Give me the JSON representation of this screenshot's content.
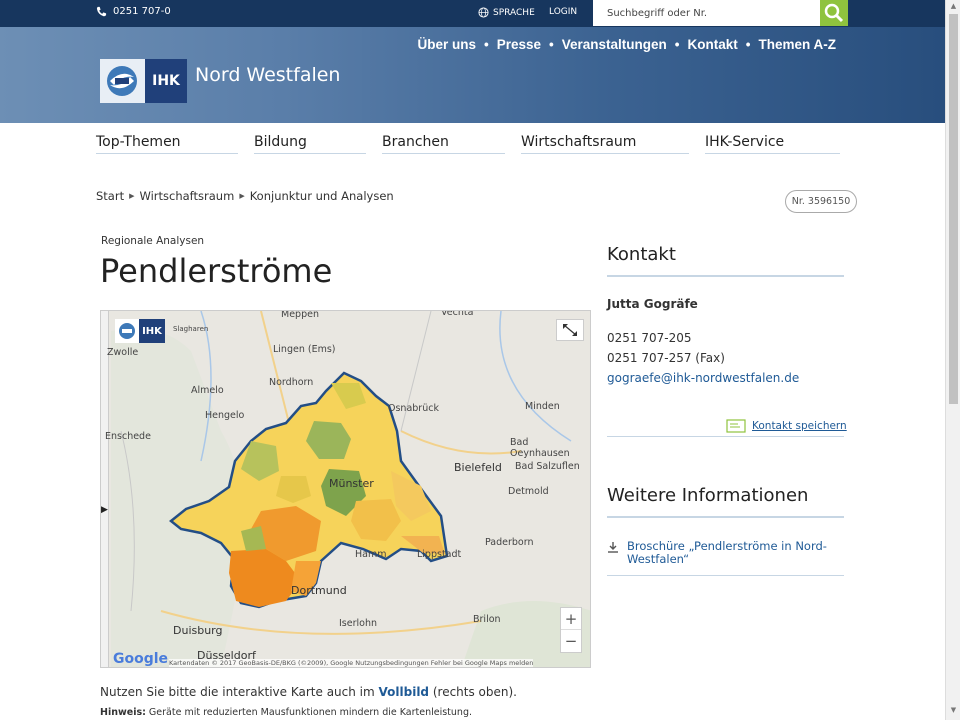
{
  "topbar": {
    "phone": "0251 707-0",
    "language_label": "SPRACHE",
    "login_label": "LOGIN",
    "search_placeholder": "Suchbegriff oder Nr."
  },
  "header": {
    "logo_text": "IHK",
    "brand": "Nord Westfalen",
    "nav": [
      "Über uns",
      "Presse",
      "Veranstaltungen",
      "Kontakt",
      "Themen A-Z"
    ]
  },
  "subnav": [
    "Top-Themen",
    "Bildung",
    "Branchen",
    "Wirtschaftsraum",
    "IHK-Service"
  ],
  "breadcrumb": [
    "Start",
    "Wirtschaftsraum",
    "Konjunktur und Analysen"
  ],
  "doc_number": "Nr. 3596150",
  "page": {
    "kicker": "Regionale Analysen",
    "title": "Pendlerströme"
  },
  "map": {
    "logo_text": "IHK",
    "attribution": "Kartendaten © 2017 GeoBasis-DE/BKG (©2009), Google   Nutzungsbedingungen   Fehler bei Google Maps melden",
    "google": "Google",
    "zoom_in": "+",
    "zoom_out": "−",
    "labels": [
      "Meppen",
      "Vechta",
      "Zwolle",
      "Lingen (Ems)",
      "Almelo",
      "Nordhorn",
      "Hengelo",
      "Osnabrück",
      "Minden",
      "Bielefeld",
      "Bad Oeynhausen",
      "Bad Salzuflen",
      "Detmold",
      "Münster",
      "Paderborn",
      "Hamm",
      "Lippstadt",
      "Dortmund",
      "Duisburg",
      "Iserlohn",
      "Brilon",
      "Düsseldorf",
      "Enschede",
      "Slagharen"
    ]
  },
  "contact": {
    "heading": "Kontakt",
    "name": "Jutta Gogräfe",
    "phone": "0251 707-205",
    "fax": "0251 707-257 (Fax)",
    "email": "gograefe@ihk-nordwestfalen.de",
    "save_label": "Kontakt speichern"
  },
  "more": {
    "heading": "Weitere Informationen",
    "link": "Broschüre „Pendlerströme in Nord-Westfalen“"
  },
  "notes": {
    "text_pre": "Nutzen Sie bitte die interaktive Karte auch im ",
    "text_link": "Vollbild",
    "text_post": " (rechts oben).",
    "hint_label": "Hinweis:",
    "hint_text": " Geräte mit reduzierten Mausfunktionen mindern die Kartenleistung."
  },
  "colors": {
    "topbar": "#17365e",
    "accent_green": "#8fc33e",
    "link": "#1f5a96"
  }
}
